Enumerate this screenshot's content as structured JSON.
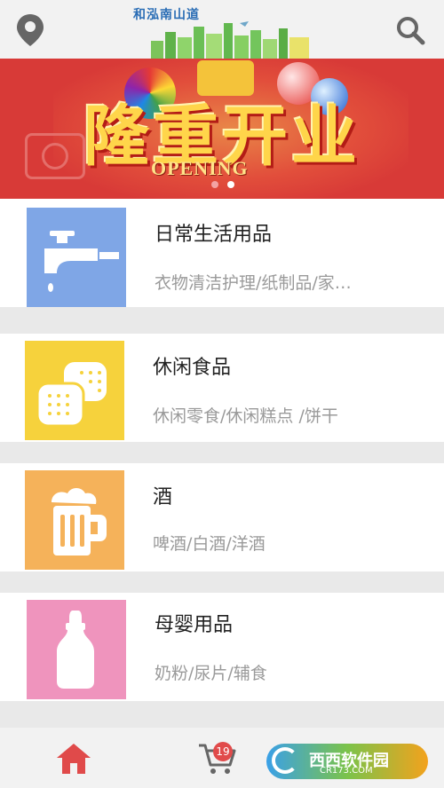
{
  "header": {
    "logo_text": "和泓南山道"
  },
  "banner": {
    "title": "隆重开业",
    "subtitle": "OPENING",
    "slides": 2,
    "active_slide": 2
  },
  "categories": [
    {
      "title": "日常生活用品",
      "subtitle": "衣物清洁护理/纸制品/家…",
      "color": "#7fa6e6",
      "icon": "faucet-icon"
    },
    {
      "title": "休闲食品",
      "subtitle": "休闲零食/休闲糕点 /饼干",
      "color": "#f6d23c",
      "icon": "biscuit-icon"
    },
    {
      "title": "酒",
      "subtitle": "啤酒/白酒/洋酒",
      "color": "#f5b25a",
      "icon": "beer-mug-icon"
    },
    {
      "title": "母婴用品",
      "subtitle": "奶粉/尿片/辅食",
      "color": "#ef94bd",
      "icon": "baby-bottle-icon"
    }
  ],
  "bottom_nav": {
    "cart_count": "19",
    "active_color": "#e04a4a"
  },
  "watermark": {
    "name": "西西软件园",
    "url": "CR173.COM"
  }
}
